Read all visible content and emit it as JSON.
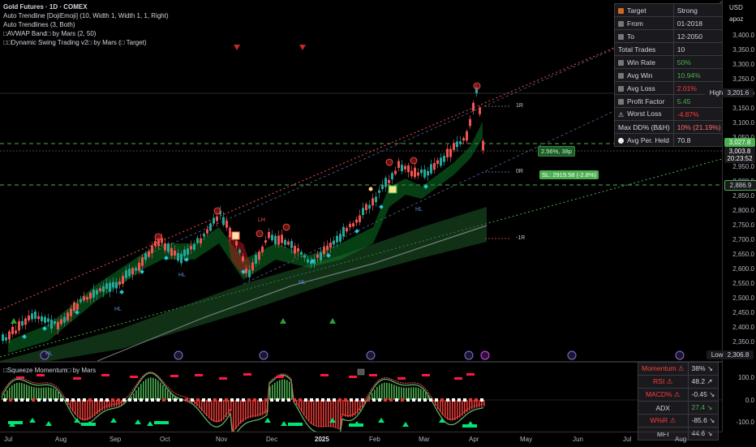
{
  "chart_header": {
    "title": "Gold Futures · 1D · COMEX",
    "indicators": [
      "Auto Trendline [DojiEmoji] (10, Width 1, Width 1, 1, Right)",
      "Auto Trendlines (3, Both)",
      "□AVWAP Band□ by Mars (2, 50)",
      "□□Dynamic Swing Trading v2□ by Mars (□ Target)"
    ]
  },
  "currency": {
    "code": "USD",
    "sub": "apoz"
  },
  "colors": {
    "up": "#26a69a",
    "down": "#ef5350",
    "green": "#4caf50",
    "red": "#ff3b3b",
    "accent": "#8a6fd1"
  },
  "stats_table": {
    "rows": [
      {
        "icon": "target-icon",
        "label": "Target",
        "value": "Strong",
        "value_color": "#d1d4dc"
      },
      {
        "icon": "calendar-icon",
        "label": "From",
        "value": "01-2018",
        "value_color": "#d1d4dc"
      },
      {
        "icon": "calendar-icon",
        "label": "To",
        "value": "12-2050",
        "value_color": "#d1d4dc"
      },
      {
        "icon": "",
        "label": "Total Trades",
        "value": "10",
        "value_color": "#d1d4dc"
      },
      {
        "icon": "chart-icon",
        "label": "Win Rate",
        "value": "50%",
        "value_color": "#4caf50"
      },
      {
        "icon": "chart-icon",
        "label": "Avg Win",
        "value": "10.94%",
        "value_color": "#4caf50"
      },
      {
        "icon": "chart-icon",
        "label": "Avg Loss",
        "value": "2.01%",
        "value_color": "#ff3b3b"
      },
      {
        "icon": "scale-icon",
        "label": "Profit Factor",
        "value": "5.45",
        "value_color": "#4caf50"
      },
      {
        "icon": "warning-icon",
        "label": "Worst Loss",
        "value": "-4.87%",
        "value_color": "#ff3b3b"
      },
      {
        "icon": "",
        "label": "Max DD% (B&H)",
        "value": "10% (21.19%)",
        "value_color": "#ff6b6b"
      },
      {
        "icon": "clock-icon",
        "label": "Avg Per. Held",
        "value": "70.8",
        "value_color": "#d1d4dc"
      }
    ]
  },
  "momentum_table": {
    "rows": [
      {
        "label": "Momentum ⚠",
        "value": "38% ↘",
        "label_color": "#ff3b3b",
        "value_color": "#d1d4dc"
      },
      {
        "label": "RSI ⚠",
        "value": "48.2 ↗",
        "label_color": "#ff3b3b",
        "value_color": "#d1d4dc"
      },
      {
        "label": "MACD% ⚠",
        "value": "-0.45 ↘",
        "label_color": "#ff3b3b",
        "value_color": "#d1d4dc"
      },
      {
        "label": "ADX",
        "value": "27.4 ↘",
        "label_color": "#d1d4dc",
        "value_color": "#4caf50"
      },
      {
        "label": "W%R ⚠",
        "value": "-85.6 ↘",
        "label_color": "#ff3b3b",
        "value_color": "#d1d4dc"
      },
      {
        "label": "MFI",
        "value": "44.6 ↘",
        "label_color": "#d1d4dc",
        "value_color": "#d1d4dc"
      }
    ]
  },
  "price_axis": {
    "labels": [
      "3,400.0",
      "3,350.0",
      "3,300.0",
      "3,250.0",
      "3,200.0",
      "3,150.0",
      "3,100.0",
      "3,050.0",
      "2,950.0",
      "2,900.0",
      "2,850.0",
      "2,800.0",
      "2,750.0",
      "2,700.0",
      "2,650.0",
      "2,600.0",
      "2,550.0",
      "2,500.0",
      "2,450.0",
      "2,400.0",
      "2,350.0"
    ],
    "high_label": "High",
    "high_value": "3,201.6",
    "target_value": "3,027.8",
    "last_value": "3,003.8",
    "countdown": "20:23:52",
    "level_value": "2,886.9",
    "low_label": "Low",
    "low_value": "2,306.8"
  },
  "osc_axis": {
    "labels": [
      "100.0",
      "0.0",
      "-100.0"
    ]
  },
  "time_axis": {
    "labels": [
      {
        "text": "Jul",
        "bold": false
      },
      {
        "text": "Aug",
        "bold": false
      },
      {
        "text": "Sep",
        "bold": false
      },
      {
        "text": "Oct",
        "bold": false
      },
      {
        "text": "Nov",
        "bold": false
      },
      {
        "text": "Dec",
        "bold": false
      },
      {
        "text": "2025",
        "bold": true
      },
      {
        "text": "Feb",
        "bold": false
      },
      {
        "text": "Mar",
        "bold": false
      },
      {
        "text": "Apr",
        "bold": false
      },
      {
        "text": "May",
        "bold": false
      },
      {
        "text": "Jun",
        "bold": false
      },
      {
        "text": "Jul",
        "bold": false
      },
      {
        "text": "Aug",
        "bold": false
      }
    ]
  },
  "annotations": {
    "target_tag": "2.56%, 38p",
    "sl_tag": "SL: 2919.58 (-2.8%)",
    "label_1r": "1R",
    "label_0r": "0R",
    "label_m1r": "-1R",
    "swing_labels": [
      "HL",
      "LH",
      "HL",
      "HL",
      "HL",
      "HL"
    ]
  },
  "oscillator": {
    "title": "□Squeeze Momentum□ by Mars"
  }
}
